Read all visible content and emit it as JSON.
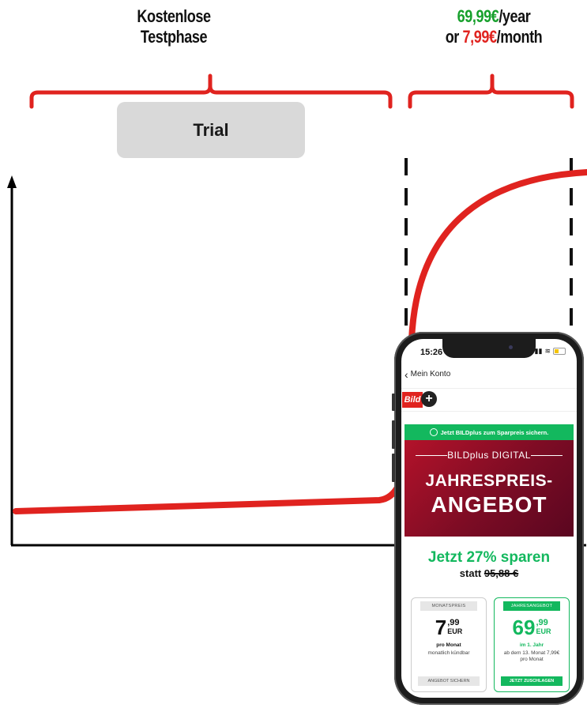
{
  "labels": {
    "left_line1": "Kostenlose",
    "left_line2": "Testphase",
    "right_price_year": "69,99€",
    "right_year_suffix": "/year",
    "right_or": "or ",
    "right_price_month": "7,99€",
    "right_month_suffix": "/month"
  },
  "trial_box": {
    "label": "Trial"
  },
  "colors": {
    "curve_red": "#e0231f",
    "green": "#17a02c",
    "axis": "#000000",
    "trial_gray": "#d9d9d9"
  },
  "phone": {
    "time": "15:26",
    "back_label": "Mein Konto",
    "logo": "Bild",
    "banner": "Jetzt BILDplus zum Sparpreis sichern.",
    "hero_sub": "BILDplus DIGITAL",
    "hero_title1": "JAHRESPREIS-",
    "hero_title2": "ANGEBOT",
    "save_text": "Jetzt 27% sparen",
    "statt_prefix": "statt ",
    "statt_price": "95,88 €",
    "monthly": {
      "head": "MONATSPREIS",
      "big": "7",
      "cents": ",99",
      "cur": "EUR",
      "bold": "pro Monat",
      "note": "monatlich kündbar",
      "button": "ANGEBOT SICHERN"
    },
    "yearly": {
      "head": "JAHRESANGEBOT",
      "big": "69",
      "cents": ",99",
      "cur": "EUR",
      "bold": "im 1. Jahr",
      "note": "ab dem 13. Monat 7,99€ pro Monat",
      "button": "JETZT ZUSCHLAGEN"
    }
  }
}
